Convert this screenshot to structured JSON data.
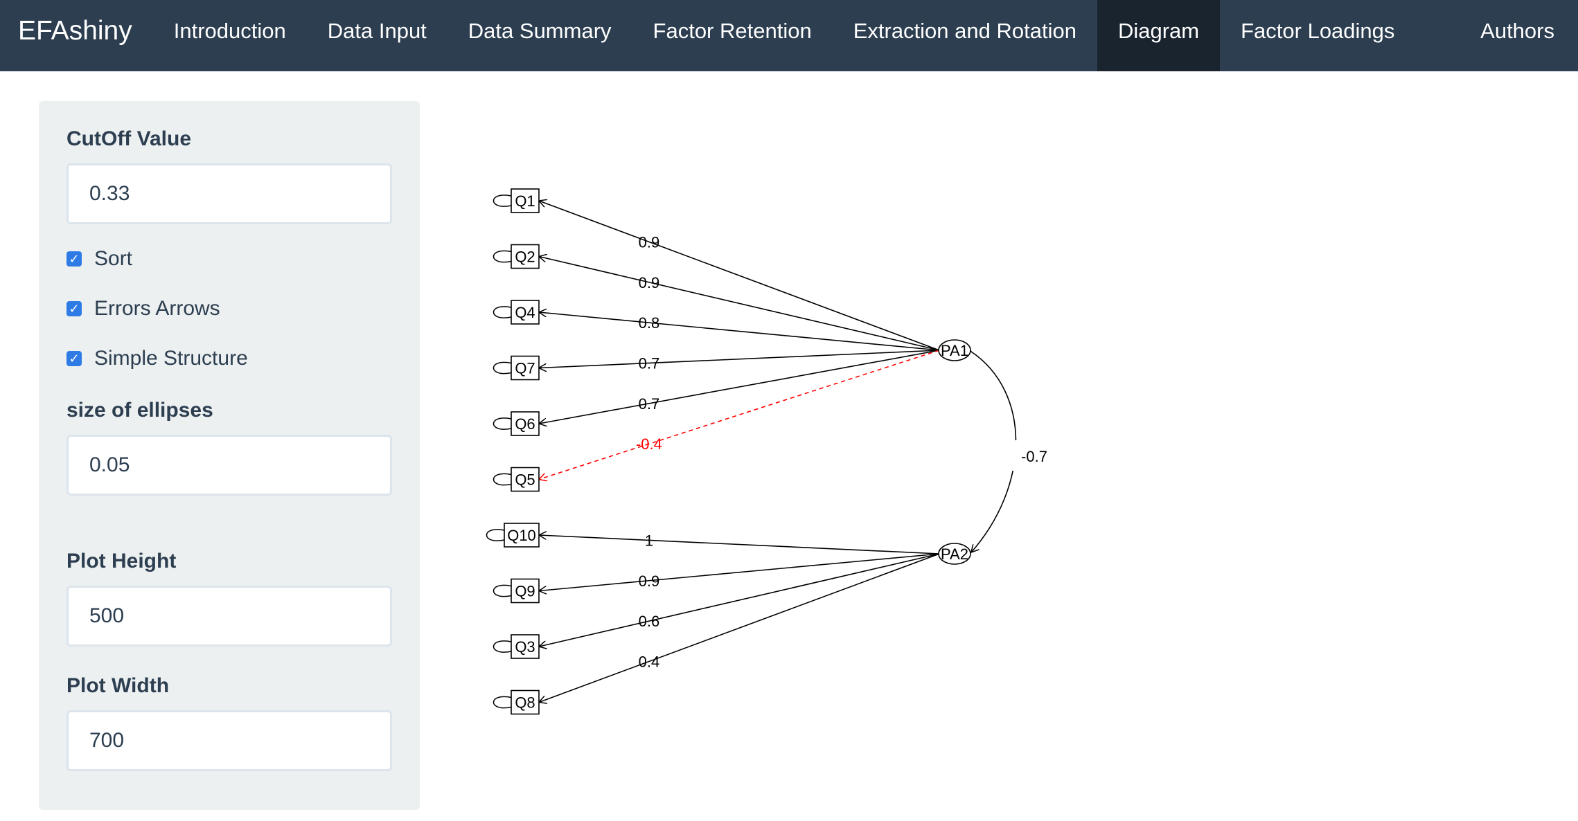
{
  "navbar": {
    "brand": "EFAshiny",
    "items": [
      {
        "label": "Introduction",
        "active": false
      },
      {
        "label": "Data Input",
        "active": false
      },
      {
        "label": "Data Summary",
        "active": false
      },
      {
        "label": "Factor Retention",
        "active": false
      },
      {
        "label": "Extraction and Rotation",
        "active": false
      },
      {
        "label": "Diagram",
        "active": true
      },
      {
        "label": "Factor Loadings",
        "active": false
      }
    ],
    "right_item": "Authors"
  },
  "sidebar": {
    "cutoff": {
      "label": "CutOff Value",
      "value": "0.33"
    },
    "checkboxes": [
      {
        "label": "Sort",
        "checked": true
      },
      {
        "label": "Errors Arrows",
        "checked": true
      },
      {
        "label": "Simple Structure",
        "checked": true
      }
    ],
    "ellipse_size": {
      "label": "size of ellipses",
      "value": "0.05"
    },
    "plot_height": {
      "label": "Plot Height",
      "value": "500"
    },
    "plot_width": {
      "label": "Plot Width",
      "value": "700"
    }
  },
  "diagram": {
    "factors": [
      "PA1",
      "PA2"
    ],
    "items": [
      "Q1",
      "Q2",
      "Q4",
      "Q7",
      "Q6",
      "Q5",
      "Q10",
      "Q9",
      "Q3",
      "Q8"
    ],
    "loadings": [
      {
        "item": "Q1",
        "factor": "PA1",
        "label": "0.9",
        "negative": false
      },
      {
        "item": "Q2",
        "factor": "PA1",
        "label": "0.9",
        "negative": false
      },
      {
        "item": "Q4",
        "factor": "PA1",
        "label": "0.8",
        "negative": false
      },
      {
        "item": "Q7",
        "factor": "PA1",
        "label": "0.7",
        "negative": false
      },
      {
        "item": "Q6",
        "factor": "PA1",
        "label": "0.7",
        "negative": false
      },
      {
        "item": "Q5",
        "factor": "PA1",
        "label": "-0.4",
        "negative": true
      },
      {
        "item": "Q10",
        "factor": "PA2",
        "label": "1",
        "negative": false
      },
      {
        "item": "Q9",
        "factor": "PA2",
        "label": "0.9",
        "negative": false
      },
      {
        "item": "Q3",
        "factor": "PA2",
        "label": "0.6",
        "negative": false
      },
      {
        "item": "Q8",
        "factor": "PA2",
        "label": "0.4",
        "negative": false
      }
    ],
    "correlation": {
      "from": "PA1",
      "to": "PA2",
      "label": "-0.7"
    },
    "colors": {
      "positive": "#000000",
      "negative": "#ff0000"
    }
  }
}
